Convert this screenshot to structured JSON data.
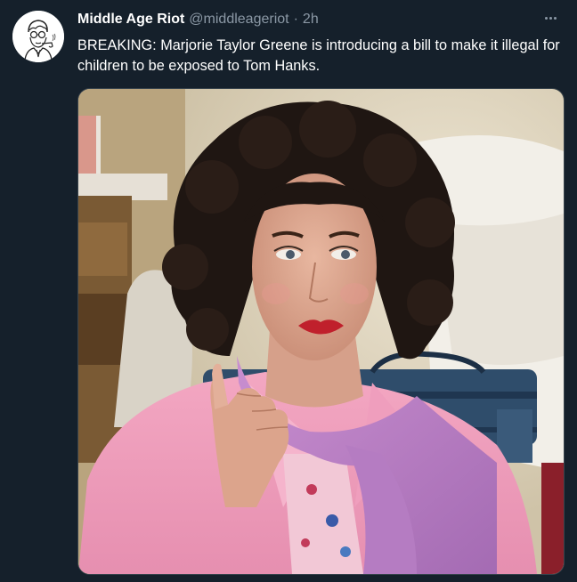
{
  "tweet": {
    "author_name": "Middle Age Riot",
    "handle": "@middleageriot",
    "separator": "·",
    "time": "2h",
    "text": "BREAKING: Marjorie Taylor Greene is introducing a bill to make it illegal for children to be exposed to Tom Hanks.",
    "more_icon": "more-horizontal-icon",
    "avatar_icon": "avatar-illustration"
  },
  "colors": {
    "background": "#15202b",
    "secondary_text": "#8b98a5",
    "primary_text": "#ffffff",
    "border": "#38444d"
  }
}
